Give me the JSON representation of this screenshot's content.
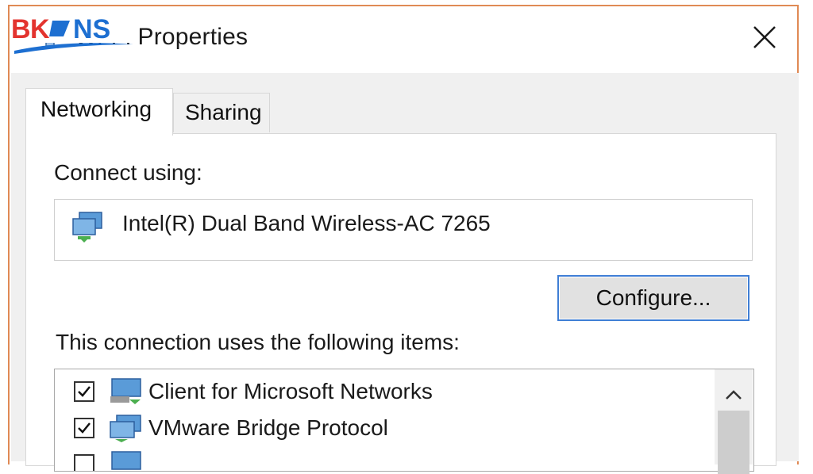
{
  "logo": {
    "text_b": "B",
    "text_k": "K",
    "text_ns": "NS",
    "red": "#e3342f",
    "blue": "#1d6fd1"
  },
  "window": {
    "title": "Wi-Fi Properties"
  },
  "tabs": [
    {
      "label": "Networking",
      "active": true
    },
    {
      "label": "Sharing",
      "active": false
    }
  ],
  "connect": {
    "label": "Connect using:",
    "adapter_name": "Intel(R) Dual Band Wireless-AC 7265",
    "adapter_icon": "network-adapter-icon"
  },
  "configure_button": {
    "label": "Configure..."
  },
  "items_section": {
    "label": "This connection uses the following items:",
    "items": [
      {
        "label": "Client for Microsoft Networks",
        "checked": true,
        "icon": "network-client-icon"
      },
      {
        "label": "VMware Bridge Protocol",
        "checked": true,
        "icon": "network-protocol-icon"
      }
    ]
  },
  "colors": {
    "accent_border": "#3f7ed5",
    "window_border": "#e08a55",
    "dialog_bg": "#f0f0f0"
  }
}
